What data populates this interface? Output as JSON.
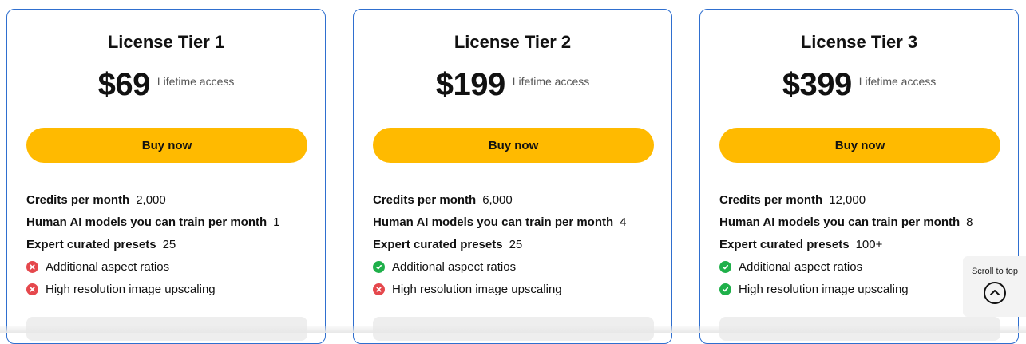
{
  "plans": [
    {
      "title": "License Tier 1",
      "price": "$69",
      "access": "Lifetime access",
      "button_label": "Buy now",
      "stats": [
        {
          "label": "Credits per month",
          "value": "2,000"
        },
        {
          "label": "Human AI models you can train per month",
          "value": "1"
        },
        {
          "label": "Expert curated presets",
          "value": "25"
        }
      ],
      "features": [
        {
          "label": "Additional aspect ratios",
          "status": "x-circle-icon"
        },
        {
          "label": "High resolution image upscaling",
          "status": "x-circle-icon"
        }
      ]
    },
    {
      "title": "License Tier 2",
      "price": "$199",
      "access": "Lifetime access",
      "button_label": "Buy now",
      "stats": [
        {
          "label": "Credits per month",
          "value": "6,000"
        },
        {
          "label": "Human AI models you can train per month",
          "value": "4"
        },
        {
          "label": "Expert curated presets",
          "value": "25"
        }
      ],
      "features": [
        {
          "label": "Additional aspect ratios",
          "status": "check-circle-icon"
        },
        {
          "label": "High resolution image upscaling",
          "status": "x-circle-icon"
        }
      ]
    },
    {
      "title": "License Tier 3",
      "price": "$399",
      "access": "Lifetime access",
      "button_label": "Buy now",
      "stats": [
        {
          "label": "Credits per month",
          "value": "12,000"
        },
        {
          "label": "Human AI models you can train per month",
          "value": "8"
        },
        {
          "label": "Expert curated presets",
          "value": "100+"
        }
      ],
      "features": [
        {
          "label": "Additional aspect ratios",
          "status": "check-circle-icon"
        },
        {
          "label": "High resolution image upscaling",
          "status": "check-circle-icon"
        }
      ]
    }
  ],
  "scroll_to_top": {
    "label": "Scroll to top",
    "icon": "chevron-up-icon"
  },
  "colors": {
    "card_border": "#2f6fcf",
    "button": "#ffba00",
    "included": "#1fb04a",
    "excluded": "#e5484d"
  }
}
